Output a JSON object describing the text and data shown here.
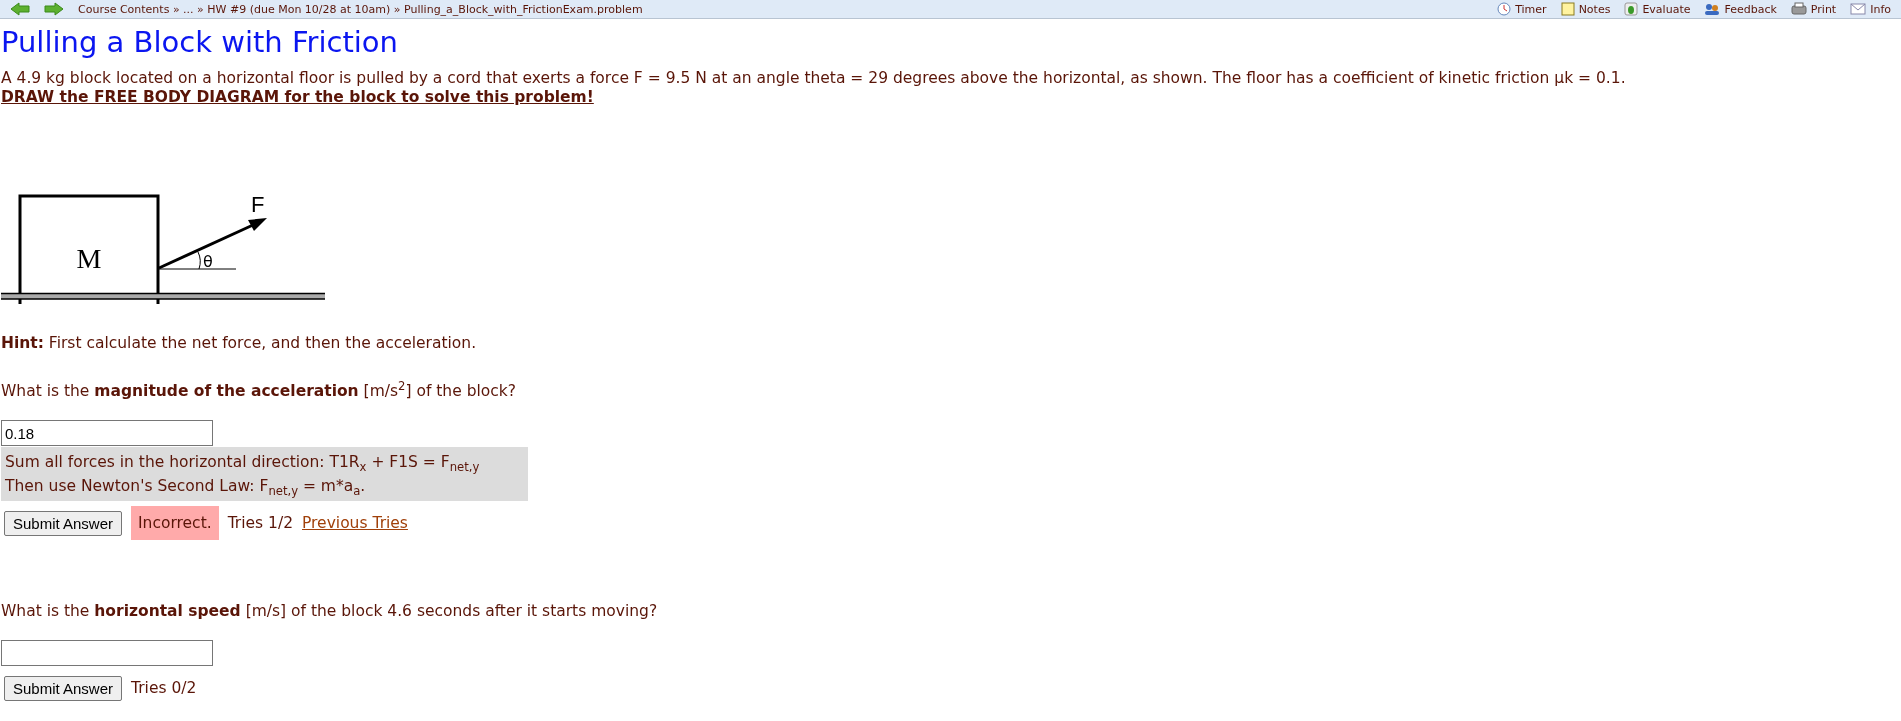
{
  "nav": {
    "breadcrumb": "Course Contents » ... » HW #9 (due Mon 10/28 at 10am) » Pulling_a_Block_with_FrictionExam.problem",
    "tools": [
      {
        "kind": "timer",
        "label": "Timer"
      },
      {
        "kind": "notes",
        "label": "Notes"
      },
      {
        "kind": "evaluate",
        "label": "Evaluate"
      },
      {
        "kind": "feedback",
        "label": "Feedback"
      },
      {
        "kind": "print",
        "label": "Print"
      },
      {
        "kind": "info",
        "label": "Info"
      }
    ]
  },
  "title": "Pulling a Block with Friction",
  "problem": {
    "text": "A 4.9 kg block located on a horizontal floor is pulled by a cord that exerts a force F = 9.5 N at an angle theta = 29 degrees above the horizontal, as shown. The floor has a coefficient of kinetic friction μk = 0.1.",
    "link": "DRAW the FREE BODY DIAGRAM for the block to solve this problem!"
  },
  "diagram": {
    "mass_label": "M",
    "force_label": "F",
    "angle_label": "θ"
  },
  "hint": "**Hint:** First calculate the net force, and then the acceleration.",
  "questions": [
    {
      "prompt": "What is the **magnitude of the acceleration** [m/s$^{2}$] of the block?",
      "value": "0.18",
      "feedback": [
        "Sum all forces in the horizontal direction: T1R$_{x}$ + F1S = F$_{net,y}$",
        "Then use Newton's Second Law: F$_{net,y}$ = m*a$_{a}$."
      ],
      "button": "Submit Answer",
      "status": {
        "kind": "incorrect",
        "label": "Incorrect."
      },
      "tries": "Tries 1/2",
      "link": "Previous Tries"
    },
    {
      "prompt": "What is the **horizontal speed** [m/s] of the block 4.6 seconds after it starts moving?",
      "button": "Submit Answer",
      "tries": "Tries 0/2"
    }
  ]
}
